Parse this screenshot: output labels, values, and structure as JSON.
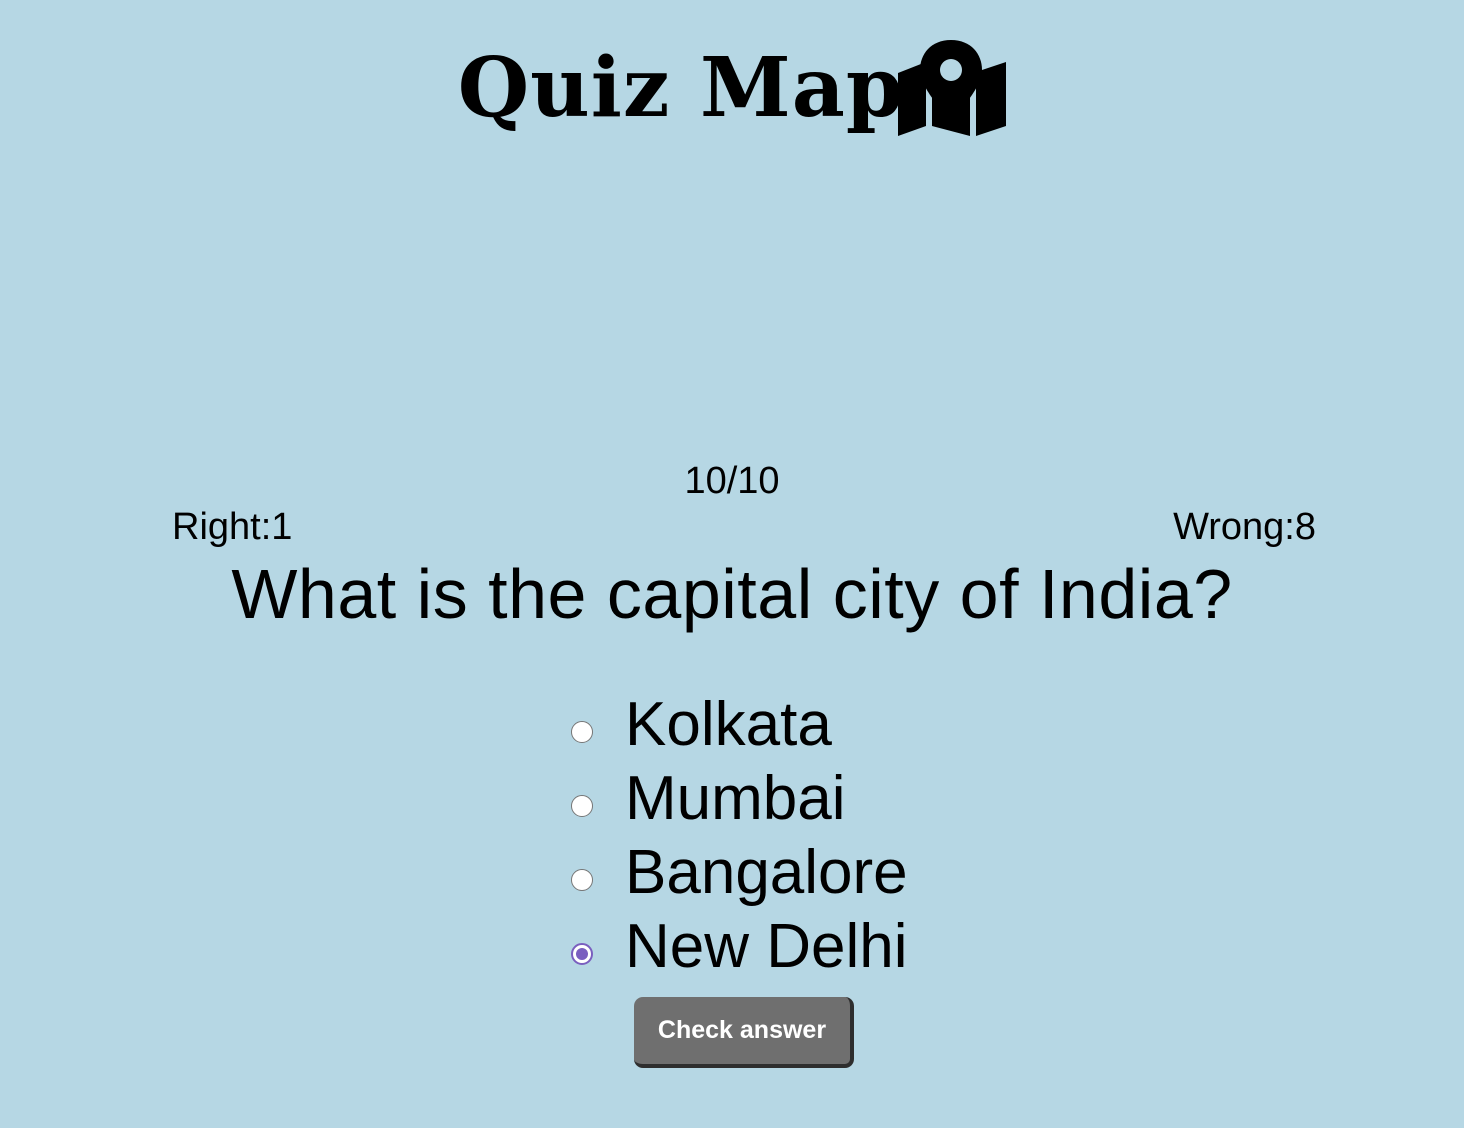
{
  "header": {
    "title": "Quiz Map",
    "icon": "map-location-icon"
  },
  "progress": {
    "counter": "10/10",
    "right_label": "Right:1",
    "wrong_label": "Wrong:8"
  },
  "question": {
    "text": "What is the capital city of India?",
    "options": [
      {
        "label": "Kolkata",
        "selected": false
      },
      {
        "label": "Mumbai",
        "selected": false
      },
      {
        "label": "Bangalore",
        "selected": false
      },
      {
        "label": "New Delhi",
        "selected": true
      }
    ]
  },
  "actions": {
    "check_label": "Check answer"
  },
  "colors": {
    "background": "#b6d7e4",
    "button": "#6f6f6f",
    "radio_accent": "#7a5fbf"
  }
}
